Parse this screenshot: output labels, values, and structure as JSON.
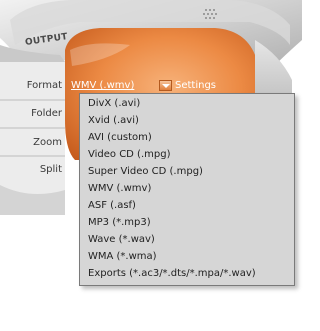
{
  "panel": {
    "output_label": "OUTPUT",
    "side_labels": [
      "Format",
      "Folder",
      "Zoom",
      "Split"
    ]
  },
  "format_bar": {
    "value": "WMV (.wmv)",
    "settings_label": "Settings"
  },
  "dropdown": {
    "items": [
      "DivX (.avi)",
      "Xvid (.avi)",
      "AVI (custom)",
      "Video CD (.mpg)",
      "Super Video CD (.mpg)",
      "WMV (.wmv)",
      "ASF (.asf)",
      "MP3 (*.mp3)",
      "Wave (*.wav)",
      "WMA (*.wma)",
      "Exports (*.ac3/*.dts/*.mpa/*.wav)"
    ]
  },
  "colors": {
    "accent_orange": "#e4732a",
    "dropdown_bg": "#d6d6d6"
  }
}
